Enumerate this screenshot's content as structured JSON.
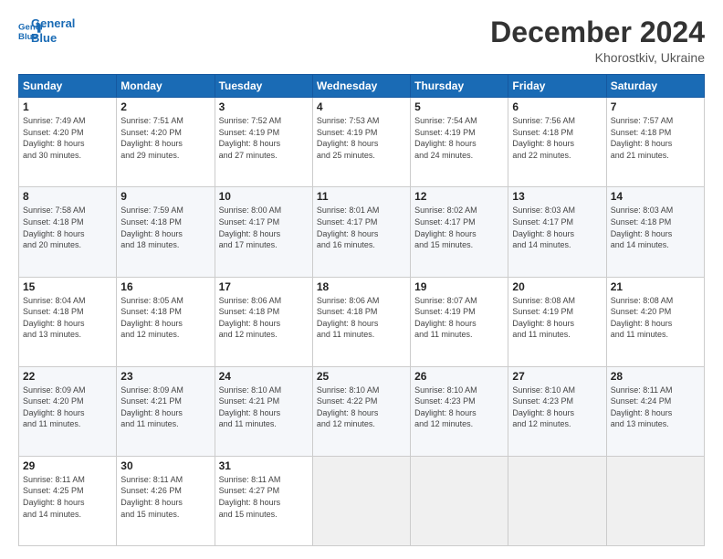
{
  "logo": {
    "line1": "General",
    "line2": "Blue"
  },
  "title": "December 2024",
  "subtitle": "Khorostkiv, Ukraine",
  "weekdays": [
    "Sunday",
    "Monday",
    "Tuesday",
    "Wednesday",
    "Thursday",
    "Friday",
    "Saturday"
  ],
  "weeks": [
    [
      {
        "day": "1",
        "info": "Sunrise: 7:49 AM\nSunset: 4:20 PM\nDaylight: 8 hours\nand 30 minutes."
      },
      {
        "day": "2",
        "info": "Sunrise: 7:51 AM\nSunset: 4:20 PM\nDaylight: 8 hours\nand 29 minutes."
      },
      {
        "day": "3",
        "info": "Sunrise: 7:52 AM\nSunset: 4:19 PM\nDaylight: 8 hours\nand 27 minutes."
      },
      {
        "day": "4",
        "info": "Sunrise: 7:53 AM\nSunset: 4:19 PM\nDaylight: 8 hours\nand 25 minutes."
      },
      {
        "day": "5",
        "info": "Sunrise: 7:54 AM\nSunset: 4:19 PM\nDaylight: 8 hours\nand 24 minutes."
      },
      {
        "day": "6",
        "info": "Sunrise: 7:56 AM\nSunset: 4:18 PM\nDaylight: 8 hours\nand 22 minutes."
      },
      {
        "day": "7",
        "info": "Sunrise: 7:57 AM\nSunset: 4:18 PM\nDaylight: 8 hours\nand 21 minutes."
      }
    ],
    [
      {
        "day": "8",
        "info": "Sunrise: 7:58 AM\nSunset: 4:18 PM\nDaylight: 8 hours\nand 20 minutes."
      },
      {
        "day": "9",
        "info": "Sunrise: 7:59 AM\nSunset: 4:18 PM\nDaylight: 8 hours\nand 18 minutes."
      },
      {
        "day": "10",
        "info": "Sunrise: 8:00 AM\nSunset: 4:17 PM\nDaylight: 8 hours\nand 17 minutes."
      },
      {
        "day": "11",
        "info": "Sunrise: 8:01 AM\nSunset: 4:17 PM\nDaylight: 8 hours\nand 16 minutes."
      },
      {
        "day": "12",
        "info": "Sunrise: 8:02 AM\nSunset: 4:17 PM\nDaylight: 8 hours\nand 15 minutes."
      },
      {
        "day": "13",
        "info": "Sunrise: 8:03 AM\nSunset: 4:17 PM\nDaylight: 8 hours\nand 14 minutes."
      },
      {
        "day": "14",
        "info": "Sunrise: 8:03 AM\nSunset: 4:18 PM\nDaylight: 8 hours\nand 14 minutes."
      }
    ],
    [
      {
        "day": "15",
        "info": "Sunrise: 8:04 AM\nSunset: 4:18 PM\nDaylight: 8 hours\nand 13 minutes."
      },
      {
        "day": "16",
        "info": "Sunrise: 8:05 AM\nSunset: 4:18 PM\nDaylight: 8 hours\nand 12 minutes."
      },
      {
        "day": "17",
        "info": "Sunrise: 8:06 AM\nSunset: 4:18 PM\nDaylight: 8 hours\nand 12 minutes."
      },
      {
        "day": "18",
        "info": "Sunrise: 8:06 AM\nSunset: 4:18 PM\nDaylight: 8 hours\nand 11 minutes."
      },
      {
        "day": "19",
        "info": "Sunrise: 8:07 AM\nSunset: 4:19 PM\nDaylight: 8 hours\nand 11 minutes."
      },
      {
        "day": "20",
        "info": "Sunrise: 8:08 AM\nSunset: 4:19 PM\nDaylight: 8 hours\nand 11 minutes."
      },
      {
        "day": "21",
        "info": "Sunrise: 8:08 AM\nSunset: 4:20 PM\nDaylight: 8 hours\nand 11 minutes."
      }
    ],
    [
      {
        "day": "22",
        "info": "Sunrise: 8:09 AM\nSunset: 4:20 PM\nDaylight: 8 hours\nand 11 minutes."
      },
      {
        "day": "23",
        "info": "Sunrise: 8:09 AM\nSunset: 4:21 PM\nDaylight: 8 hours\nand 11 minutes."
      },
      {
        "day": "24",
        "info": "Sunrise: 8:10 AM\nSunset: 4:21 PM\nDaylight: 8 hours\nand 11 minutes."
      },
      {
        "day": "25",
        "info": "Sunrise: 8:10 AM\nSunset: 4:22 PM\nDaylight: 8 hours\nand 12 minutes."
      },
      {
        "day": "26",
        "info": "Sunrise: 8:10 AM\nSunset: 4:23 PM\nDaylight: 8 hours\nand 12 minutes."
      },
      {
        "day": "27",
        "info": "Sunrise: 8:10 AM\nSunset: 4:23 PM\nDaylight: 8 hours\nand 12 minutes."
      },
      {
        "day": "28",
        "info": "Sunrise: 8:11 AM\nSunset: 4:24 PM\nDaylight: 8 hours\nand 13 minutes."
      }
    ],
    [
      {
        "day": "29",
        "info": "Sunrise: 8:11 AM\nSunset: 4:25 PM\nDaylight: 8 hours\nand 14 minutes."
      },
      {
        "day": "30",
        "info": "Sunrise: 8:11 AM\nSunset: 4:26 PM\nDaylight: 8 hours\nand 15 minutes."
      },
      {
        "day": "31",
        "info": "Sunrise: 8:11 AM\nSunset: 4:27 PM\nDaylight: 8 hours\nand 15 minutes."
      },
      null,
      null,
      null,
      null
    ]
  ]
}
